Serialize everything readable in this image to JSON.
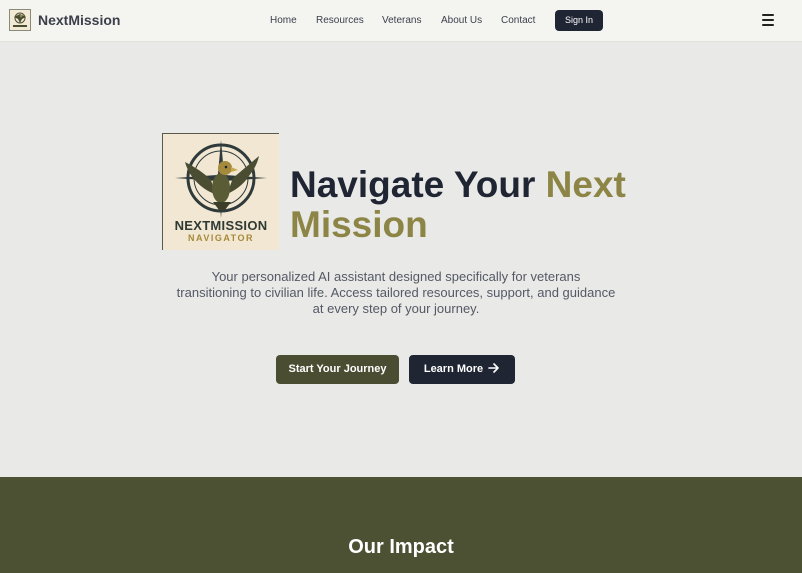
{
  "header": {
    "brand_name": "NextMission",
    "nav_items": [
      "Home",
      "Resources",
      "Veterans",
      "About Us",
      "Contact"
    ],
    "signin_label": "Sign In",
    "menu_icon": "hamburger-menu-icon"
  },
  "hero": {
    "logo": {
      "name": "NEXTMISSION",
      "sub": "NAVIGATOR"
    },
    "title_part1": "Navigate Your ",
    "title_accent1": "Next",
    "title_accent2": "Mission",
    "description": "Your personalized AI assistant designed specifically for veterans transitioning to civilian life. Access tailored resources, support, and guidance at every step of your journey.",
    "primary_button": "Start Your Journey",
    "secondary_button": "Learn More"
  },
  "impact": {
    "title": "Our Impact"
  },
  "colors": {
    "accent": "#8c8545",
    "olive": "#4a4d31",
    "navy": "#1f2533"
  }
}
